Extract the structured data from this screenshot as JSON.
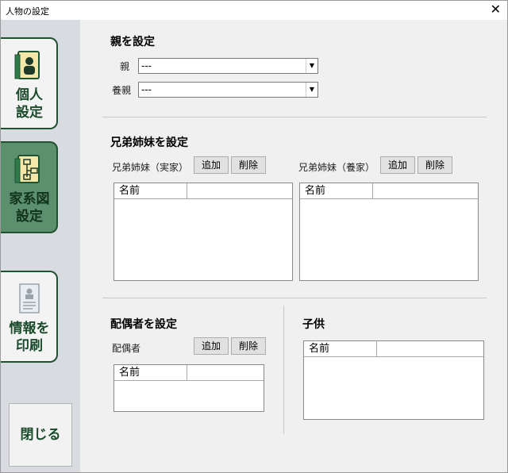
{
  "window": {
    "title": "人物の設定",
    "close_glyph": "✕"
  },
  "sidebar": {
    "items": [
      {
        "label": "個人\n設定",
        "icon": "person-book-icon",
        "active": false
      },
      {
        "label": "家系図\n設定",
        "icon": "family-tree-icon",
        "active": true
      },
      {
        "label": "情報を\n印刷",
        "icon": "document-icon",
        "active": false
      }
    ],
    "close_label": "閉じる"
  },
  "parents": {
    "title": "親を設定",
    "parent_label": "親",
    "parent_value": "---",
    "foster_label": "養親",
    "foster_value": "---"
  },
  "siblings": {
    "title": "兄弟姉妹を設定",
    "real_label": "兄弟姉妹（実家）",
    "foster_label": "兄弟姉妹（養家）",
    "add_label": "追加",
    "delete_label": "削除",
    "column": "名前"
  },
  "spouse": {
    "title": "配偶者を設定",
    "label": "配偶者",
    "add_label": "追加",
    "delete_label": "削除",
    "column": "名前"
  },
  "children": {
    "title": "子供",
    "column": "名前"
  }
}
